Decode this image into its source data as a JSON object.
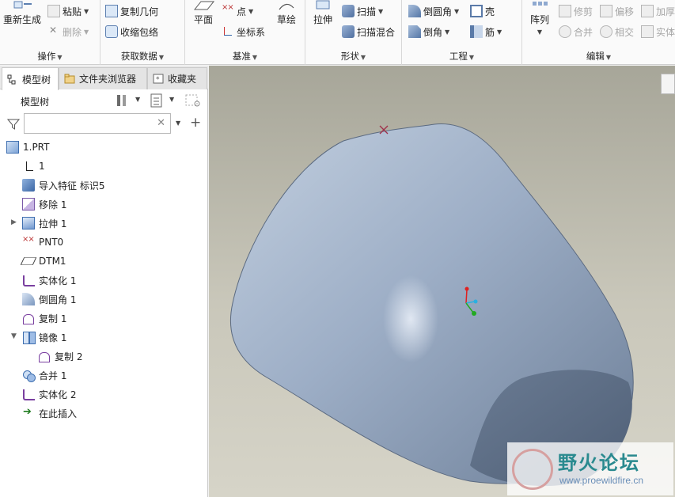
{
  "ribbon": {
    "groups": {
      "operations": "操作",
      "get_data": "获取数据",
      "datum": "基准",
      "shapes": "形状",
      "engineering": "工程",
      "editing": "编辑"
    },
    "buttons": {
      "regenerate": "重新生成",
      "paste": "粘贴",
      "delete": "删除",
      "copy_geometry": "复制几何",
      "shrinkwrap": "收缩包络",
      "plane": "平面",
      "point": "点",
      "csys": "坐标系",
      "sketch": "草绘",
      "extrude": "拉伸",
      "sweep": "扫描",
      "swept_blend": "扫描混合",
      "round": "倒圆角",
      "chamfer": "倒角",
      "shell": "壳",
      "rib": "筋",
      "pattern": "阵列",
      "trim": "修剪",
      "offset": "偏移",
      "thicken": "加厚",
      "merge": "合并",
      "intersect": "相交",
      "solidify": "实体"
    },
    "icons": [
      "regenerate-icon",
      "paste-icon",
      "delete-icon",
      "copy-geometry-icon",
      "shrinkwrap-icon",
      "plane-icon",
      "point-icon",
      "csys-icon",
      "sketch-icon",
      "extrude-icon",
      "sweep-icon",
      "swept-blend-icon",
      "round-icon",
      "chamfer-icon",
      "shell-icon",
      "rib-icon",
      "pattern-icon",
      "trim-icon",
      "offset-icon",
      "thicken-icon",
      "merge-icon",
      "intersect-icon",
      "solidify-icon"
    ]
  },
  "panel": {
    "tabs": [
      "模型树",
      "文件夹浏览器",
      "收藏夹"
    ],
    "tree_title": "模型树",
    "search_placeholder": "",
    "tree": [
      {
        "label": "1.PRT",
        "icon": "part-icon"
      },
      {
        "label": "1",
        "icon": "csys-icon"
      },
      {
        "label": "导入特征 标识5",
        "icon": "import-feature-icon"
      },
      {
        "label": "移除 1",
        "icon": "remove-icon"
      },
      {
        "label": "拉伸 1",
        "icon": "extrude-icon",
        "expandable": true
      },
      {
        "label": "PNT0",
        "icon": "datum-point-icon"
      },
      {
        "label": "DTM1",
        "icon": "datum-plane-icon"
      },
      {
        "label": "实体化 1",
        "icon": "solidify-icon"
      },
      {
        "label": "倒圆角 1",
        "icon": "round-icon"
      },
      {
        "label": "复制 1",
        "icon": "copy-icon"
      },
      {
        "label": "镜像 1",
        "icon": "mirror-icon",
        "expanded": true
      },
      {
        "label": "复制 2",
        "icon": "copy-icon",
        "child": true
      },
      {
        "label": "合并 1",
        "icon": "merge-icon"
      },
      {
        "label": "实体化 2",
        "icon": "solidify-icon"
      },
      {
        "label": "在此插入",
        "icon": "insert-here-icon"
      }
    ]
  },
  "watermark": {
    "title": "野火论坛",
    "url": "www.proewildfire.cn"
  },
  "colors": {
    "ribbon_bg": "#fafafa",
    "viewport_top": "#a7a699",
    "viewport_bottom": "#d6d4c8",
    "model_fill": "#8fa0b8",
    "watermark_text": "#2a8a8f"
  }
}
